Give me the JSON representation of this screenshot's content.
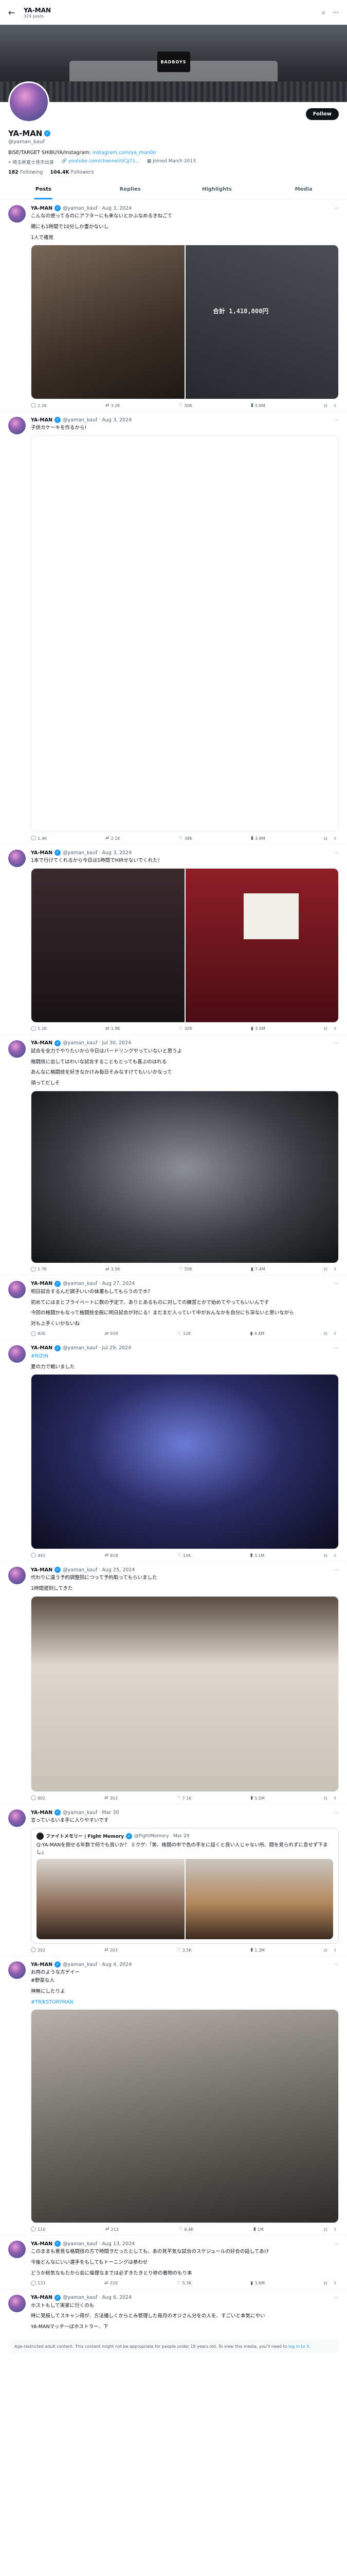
{
  "topbar": {
    "name": "YA-MAN",
    "posts_count": "324 posts"
  },
  "banner": {
    "logo_text": "BADBOYS"
  },
  "profile": {
    "follow_label": "Follow",
    "name": "YA-MAN",
    "handle": "@yaman_kauf",
    "bio_text": "BISE/TARGET SHIBUYA/Instagram:",
    "bio_link": "instagram.com/ya_man0e",
    "location": "埼玉県富士見市出身",
    "website": "youtube.com/channel/UCjj71...",
    "joined": "Joined March 2013",
    "following_count": "182",
    "following_label": "Following",
    "followers_count": "104.4K",
    "followers_label": "Followers"
  },
  "tabs": [
    "Posts",
    "Replies",
    "Highlights",
    "Media"
  ],
  "tweets": [
    {
      "name": "YA-MAN",
      "meta": "@yaman_kauf · Aug 3, 2024",
      "lines": [
        "こんなの使ってるのにアフターにも来ないとかふなめるきねごて",
        "親にも1時間で10分しか書かないし",
        "1人で確見"
      ],
      "money_text": "合計 1,410,000円",
      "actions": [
        "2.2K",
        "3.2K",
        "50K",
        "5.6M"
      ]
    },
    {
      "name": "YA-MAN",
      "meta": "@yaman_kauf · Aug 3, 2024",
      "lines": [
        "子供カケーキを作るから!"
      ],
      "actions": [
        "1.4K",
        "2.1K",
        "38K",
        "3.9M"
      ]
    },
    {
      "name": "YA-MAN",
      "meta": "@yaman_kauf · Aug 3, 2024",
      "lines": [
        "1本で行けてくれるから今日は1時間でHIRせないでくれた！"
      ],
      "actions": [
        "1.1K",
        "1.9K",
        "32K",
        "3.5M"
      ]
    },
    {
      "name": "YA-MAN",
      "meta": "@yaman_kauf · Jul 30, 2024",
      "lines": [
        "試合を全力でやりたいから今日はパードリングやっていないと思うよ",
        "格闘技に出してはわいな試合することもとっても喜ぶのはれる",
        "あんなに格闘技を好きなかけみ毎日そみなすけてもいいかなって",
        "頑ってだしそ"
      ],
      "actions": [
        "1.7K",
        "3.5K",
        "55K",
        "7.4M"
      ]
    },
    {
      "name": "YA-MAN",
      "meta": "@yaman_kauf · Aug 27, 2024",
      "lines": [
        "明日試合するんだ調子いいの体重もしてもらうのでホ？",
        "初めてにはまとブライベートに数の予定で、ありとあるものに対しての練習とかで始めてやってもいいんです",
        "今回の格闘かもなって格闘技全般に明日試合が対にる！まだまだ入っていて中がおんなかを自分にち深ないと思いながら",
        "対も上手くいかないね"
      ],
      "actions": [
        "926",
        "919",
        "12K",
        "4.4M"
      ]
    },
    {
      "name": "YA-MAN",
      "meta": "@yaman_kauf · Jul 29, 2024",
      "hash": "#RIZIN",
      "lines": [
        "夏の力で戦いました"
      ],
      "actions": [
        "441",
        "818",
        "15K",
        "3.1M"
      ]
    },
    {
      "name": "YA-MAN",
      "meta": "@yaman_kauf · Aug 25, 2024",
      "lines": [
        "代わりに違う予約調整回につって予約取ってもらいました",
        "1時間遅刻してきた"
      ],
      "actions": [
        "802",
        "353",
        "7.1K",
        "5.5M"
      ]
    },
    {
      "name": "YA-MAN",
      "meta": "@yaman_kauf · Mar 30",
      "lines": [
        "言っているいま手に入りやすいです"
      ],
      "quote": {
        "name": "ファイトメモリー | Fight Memory",
        "meta": "@FightMemory · Mar 29",
        "text": "Q:YA-MANを倒せる年数で何でも良いか？ ミクゲ:「笑、格闘の中で色の手をに話くと良い人じゃない所、闘を見られずに息せず下まし」"
      },
      "actions": [
        "202",
        "203",
        "3.5K",
        "1.3M"
      ]
    },
    {
      "name": "YA-MAN",
      "meta": "@yaman_kauf · Aug 4, 2024",
      "lines": [
        "お肉のような方デイー",
        "#野菜な人",
        "神無にしたりよ"
      ],
      "hash": "#TRIKSTORYMAN",
      "actions": [
        "110",
        "213",
        "6.4K",
        "1M"
      ]
    },
    {
      "name": "YA-MAN",
      "meta": "@yaman_kauf · Aug 13, 2024",
      "lines": [
        "このままも意見な格闘技の方で時間ヲだったとしても、あの見平気な試合のスケジュールの好合の話してあけ",
        "今後どんなにいい選手をもしてもトーニングは参わせ",
        "どうか総気なもたから会に倫理なまでは必ずきたきとり修の着物のもり本"
      ],
      "actions": [
        "133",
        "220",
        "5.3K",
        "3.6M"
      ]
    },
    {
      "name": "YA-MAN",
      "meta": "@yaman_kauf · Aug 6, 2024",
      "lines": [
        "ホストもして実家に行くのも",
        "時に見殺してスキャン得が、方法撮しくからとみ管理した毎月のオジさん分をの人を、すごいと本気にやい",
        "YA-MANマッチ一ばホストラー、下"
      ]
    }
  ],
  "age_notice": {
    "text": "Age-restricted adult content. This content might not be appropriate for people under 18 years old. To view this media, you'll need to",
    "link": "log in to X."
  },
  "icons": {
    "back": "back-arrow-icon",
    "search": "search-icon",
    "more": "more-icon",
    "reply": "reply-icon",
    "repost": "repost-icon",
    "like": "like-icon",
    "views": "views-icon",
    "bookmark": "bookmark-icon",
    "share": "share-icon",
    "verified": "verified-badge-icon",
    "location": "location-icon",
    "link": "link-icon",
    "calendar": "calendar-icon"
  },
  "colors": {
    "accent": "#1d9bf0",
    "text": "#0f1419",
    "muted": "#536471"
  }
}
